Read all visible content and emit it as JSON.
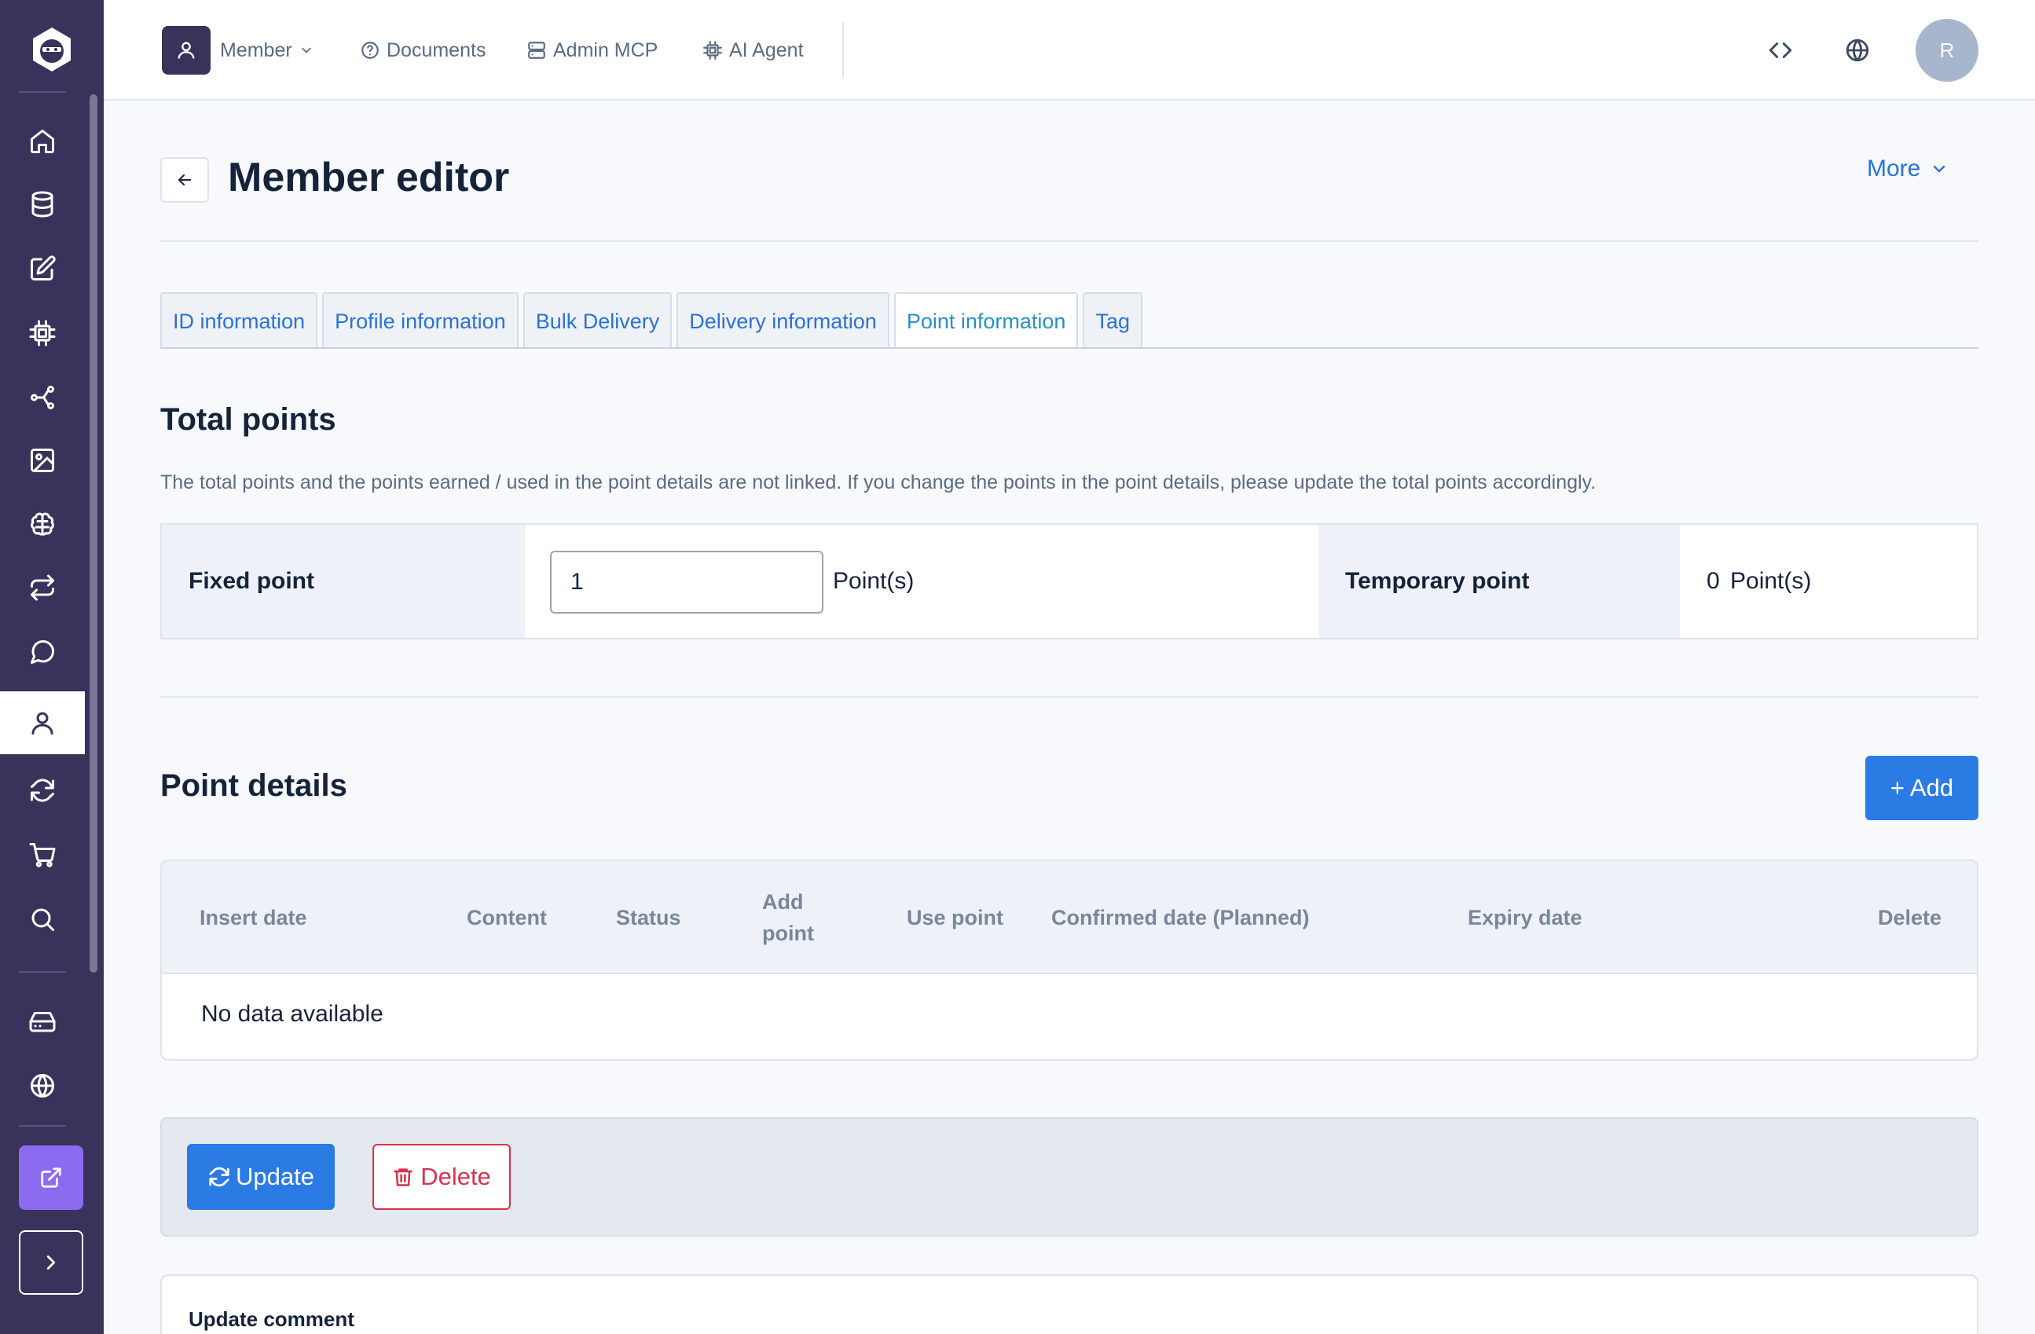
{
  "topbar": {
    "member_label": "Member",
    "documents_label": "Documents",
    "admin_mcp_label": "Admin MCP",
    "ai_agent_label": "AI Agent",
    "avatar_initial": "R"
  },
  "header": {
    "title": "Member editor",
    "more_label": "More"
  },
  "tabs": [
    {
      "label": "ID information"
    },
    {
      "label": "Profile information"
    },
    {
      "label": "Bulk Delivery"
    },
    {
      "label": "Delivery information"
    },
    {
      "label": "Point information",
      "active": true
    },
    {
      "label": "Tag"
    }
  ],
  "total_points": {
    "heading": "Total points",
    "note": "The total points and the points earned / used in the point details are not linked. If you change the points in the point details, please update the total points accordingly.",
    "fixed_label": "Fixed point",
    "fixed_value": "1",
    "fixed_unit": "Point(s)",
    "temporary_label": "Temporary point",
    "temporary_value": "0",
    "temporary_unit": "Point(s)"
  },
  "point_details": {
    "heading": "Point details",
    "add_label": "+ Add",
    "columns": {
      "insert_date": "Insert date",
      "content": "Content",
      "status": "Status",
      "add_point_1": "Add",
      "add_point_2": "point",
      "use_point": "Use point",
      "confirmed_date": "Confirmed date (Planned)",
      "expiry_date": "Expiry date",
      "delete": "Delete"
    },
    "empty_text": "No data available"
  },
  "actions": {
    "update_label": "Update",
    "delete_label": "Delete"
  },
  "comment": {
    "label": "Update comment"
  },
  "colors": {
    "sidebar": "#39325a",
    "primary": "#2a7be4",
    "danger": "#d6334f",
    "accent": "#8b6cf0"
  }
}
